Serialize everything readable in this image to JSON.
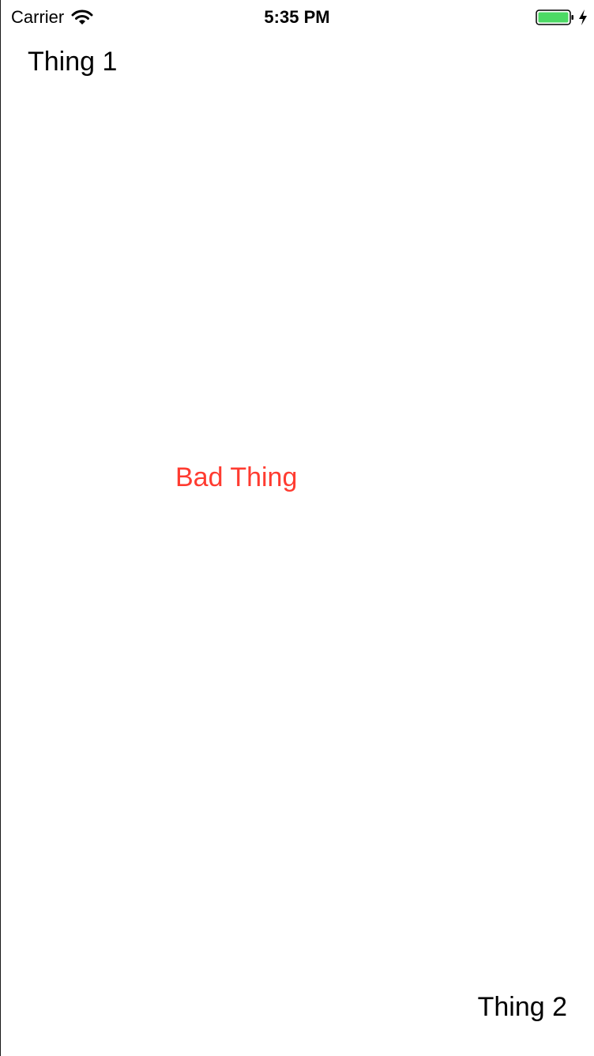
{
  "status_bar": {
    "carrier": "Carrier",
    "time": "5:35 PM",
    "icons": {
      "wifi": "wifi-icon",
      "battery": "battery-icon",
      "charging": "charging-bolt-icon"
    },
    "battery_color": "#4cd964"
  },
  "labels": {
    "thing_1": "Thing 1",
    "bad_thing": "Bad Thing",
    "thing_2": "Thing 2"
  },
  "colors": {
    "bad_thing": "#ff3b30",
    "text": "#000000",
    "background": "#ffffff"
  }
}
